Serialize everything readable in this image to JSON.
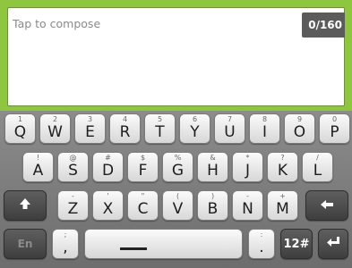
{
  "compose": {
    "placeholder": "Tap to compose",
    "counter": "0/160"
  },
  "keyboard": {
    "row1": [
      {
        "main": "Q",
        "sub": "1"
      },
      {
        "main": "W",
        "sub": "2"
      },
      {
        "main": "E",
        "sub": "3"
      },
      {
        "main": "R",
        "sub": "4"
      },
      {
        "main": "T",
        "sub": "5"
      },
      {
        "main": "Y",
        "sub": "6"
      },
      {
        "main": "U",
        "sub": "7"
      },
      {
        "main": "I",
        "sub": "8"
      },
      {
        "main": "O",
        "sub": "9"
      },
      {
        "main": "P",
        "sub": "0"
      }
    ],
    "row2": [
      {
        "main": "A",
        "sub": "!"
      },
      {
        "main": "S",
        "sub": "@"
      },
      {
        "main": "D",
        "sub": "#"
      },
      {
        "main": "F",
        "sub": "$"
      },
      {
        "main": "G",
        "sub": "%"
      },
      {
        "main": "H",
        "sub": "&"
      },
      {
        "main": "J",
        "sub": "*"
      },
      {
        "main": "K",
        "sub": "?"
      },
      {
        "main": "L",
        "sub": "/"
      }
    ],
    "row3": [
      {
        "main": "Z",
        "sub": "-"
      },
      {
        "main": "X",
        "sub": "'"
      },
      {
        "main": "C",
        "sub": "\""
      },
      {
        "main": "V",
        "sub": "("
      },
      {
        "main": "B",
        "sub": ")"
      },
      {
        "main": "N",
        "sub": "-"
      },
      {
        "main": "M",
        "sub": "+"
      }
    ],
    "shift_icon": "arrow-up-icon",
    "backspace_icon": "arrow-left-icon",
    "language_label": "En",
    "comma_label": ",",
    "comma_sub": ";",
    "period_label": ".",
    "period_sub": ":",
    "symbols_label": "12#",
    "enter_icon": "enter-icon"
  },
  "colors": {
    "compose_border": "#8ec63f",
    "counter_bg": "#5b5b5b"
  }
}
